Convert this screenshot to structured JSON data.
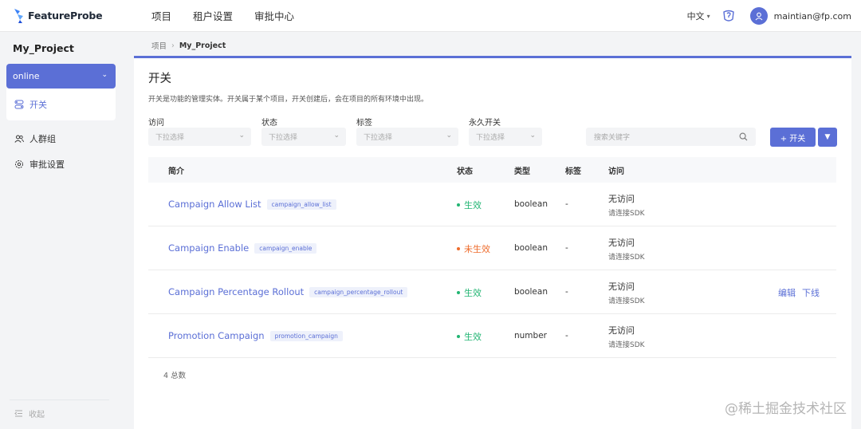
{
  "header": {
    "logo_text": "FeatureProbe",
    "nav": [
      "项目",
      "租户设置",
      "审批中心"
    ],
    "language": "中文",
    "user_email": "maintian@fp.com"
  },
  "sidebar": {
    "project_name": "My_Project",
    "environment": "online",
    "items": [
      {
        "label": "开关",
        "icon": "toggle-icon",
        "active": true
      },
      {
        "label": "人群组",
        "icon": "users-icon"
      },
      {
        "label": "审批设置",
        "icon": "gear-icon"
      }
    ],
    "collapse_label": "收起"
  },
  "breadcrumb": {
    "root": "项目",
    "current": "My_Project"
  },
  "main": {
    "title": "开关",
    "description": "开关是功能的管理实体。开关属于某个项目，开关创建后，会在项目的所有环境中出现。",
    "filters": [
      {
        "label": "访问",
        "placeholder": "下拉选择"
      },
      {
        "label": "状态",
        "placeholder": "下拉选择"
      },
      {
        "label": "标签",
        "placeholder": "下拉选择"
      },
      {
        "label": "永久开关",
        "placeholder": "下拉选择"
      }
    ],
    "search_placeholder": "搜索关键字",
    "add_button": "+ 开关",
    "columns": [
      "简介",
      "状态",
      "类型",
      "标签",
      "访问"
    ],
    "rows": [
      {
        "name": "Campaign Allow List",
        "key": "campaign_allow_list",
        "status": "生效",
        "status_color": "#22b573",
        "type": "boolean",
        "tag": "-",
        "visit": "无访问",
        "visit_sub": "请连接SDK"
      },
      {
        "name": "Campaign Enable",
        "key": "campaign_enable",
        "status": "未生效",
        "status_color": "#ee6c2c",
        "type": "boolean",
        "tag": "-",
        "visit": "无访问",
        "visit_sub": "请连接SDK"
      },
      {
        "name": "Campaign Percentage Rollout",
        "key": "campaign_percentage_rollout",
        "status": "生效",
        "status_color": "#22b573",
        "type": "boolean",
        "tag": "-",
        "visit": "无访问",
        "visit_sub": "请连接SDK",
        "actions": [
          "编辑",
          "下线"
        ]
      },
      {
        "name": "Promotion Campaign",
        "key": "promotion_campaign",
        "status": "生效",
        "status_color": "#22b573",
        "type": "number",
        "tag": "-",
        "visit": "无访问",
        "visit_sub": "请连接SDK"
      }
    ],
    "total": "4 总数"
  },
  "watermark": "@稀土掘金技术社区",
  "colors": {
    "accent": "#5b6fd6",
    "active_status": "#22b573",
    "inactive_status": "#ee6c2c"
  }
}
